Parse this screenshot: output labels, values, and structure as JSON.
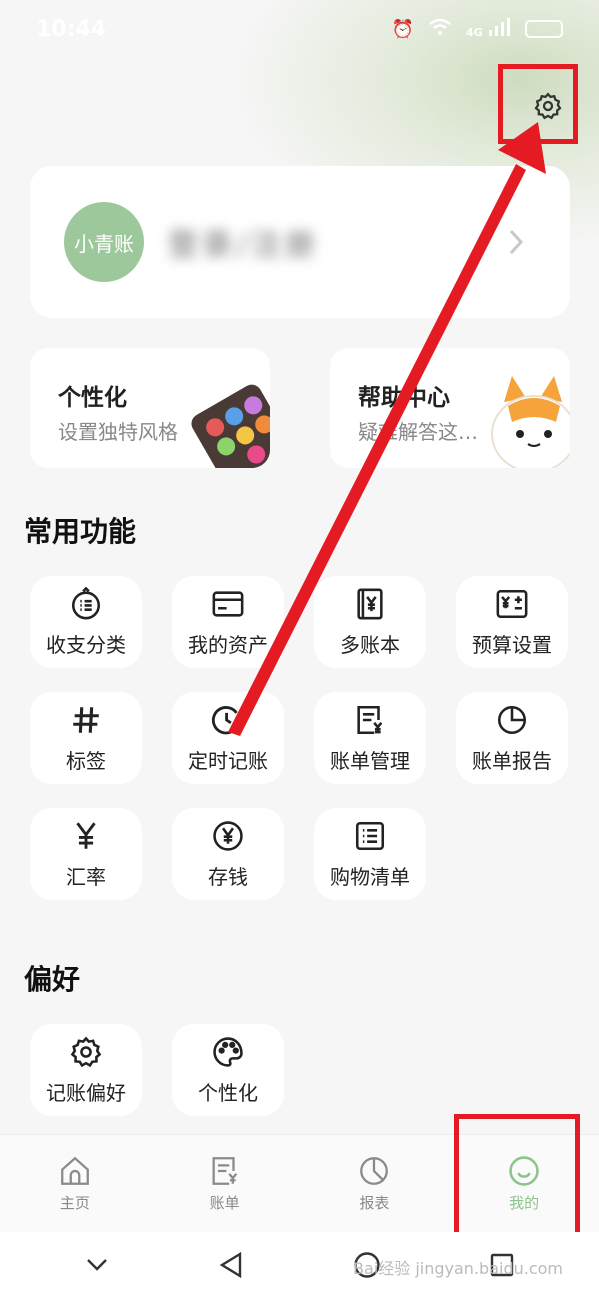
{
  "status_bar": {
    "time": "10:44",
    "network": "4G"
  },
  "profile": {
    "avatar_text": "小青账",
    "username": "登录/注册"
  },
  "features": [
    {
      "title": "个性化",
      "subtitle": "设置独特风格"
    },
    {
      "title": "帮助中心",
      "subtitle": "疑难解答这…"
    }
  ],
  "common": {
    "title": "常用功能",
    "items": [
      {
        "label": "收支分类",
        "icon": "category-icon"
      },
      {
        "label": "我的资产",
        "icon": "card-icon"
      },
      {
        "label": "多账本",
        "icon": "ledger-icon"
      },
      {
        "label": "预算设置",
        "icon": "budget-icon"
      },
      {
        "label": "标签",
        "icon": "hashtag-icon"
      },
      {
        "label": "定时记账",
        "icon": "clock-add-icon"
      },
      {
        "label": "账单管理",
        "icon": "bill-icon"
      },
      {
        "label": "账单报告",
        "icon": "pie-icon"
      },
      {
        "label": "汇率",
        "icon": "yen-icon"
      },
      {
        "label": "存钱",
        "icon": "coin-icon"
      },
      {
        "label": "购物清单",
        "icon": "list-icon"
      }
    ]
  },
  "prefs": {
    "title": "偏好",
    "items": [
      {
        "label": "记账偏好",
        "icon": "gear-icon"
      },
      {
        "label": "个性化",
        "icon": "palette-icon"
      }
    ]
  },
  "nav": [
    {
      "label": "主页",
      "icon": "home-icon"
    },
    {
      "label": "账单",
      "icon": "bill-icon"
    },
    {
      "label": "报表",
      "icon": "chart-icon"
    },
    {
      "label": "我的",
      "icon": "smile-icon"
    }
  ],
  "watermark": "Bai经验 jingyan.baidu.com",
  "colors": {
    "accent": "#8cc48a",
    "highlight": "#e51b23",
    "avatar": "#9dc89b"
  }
}
